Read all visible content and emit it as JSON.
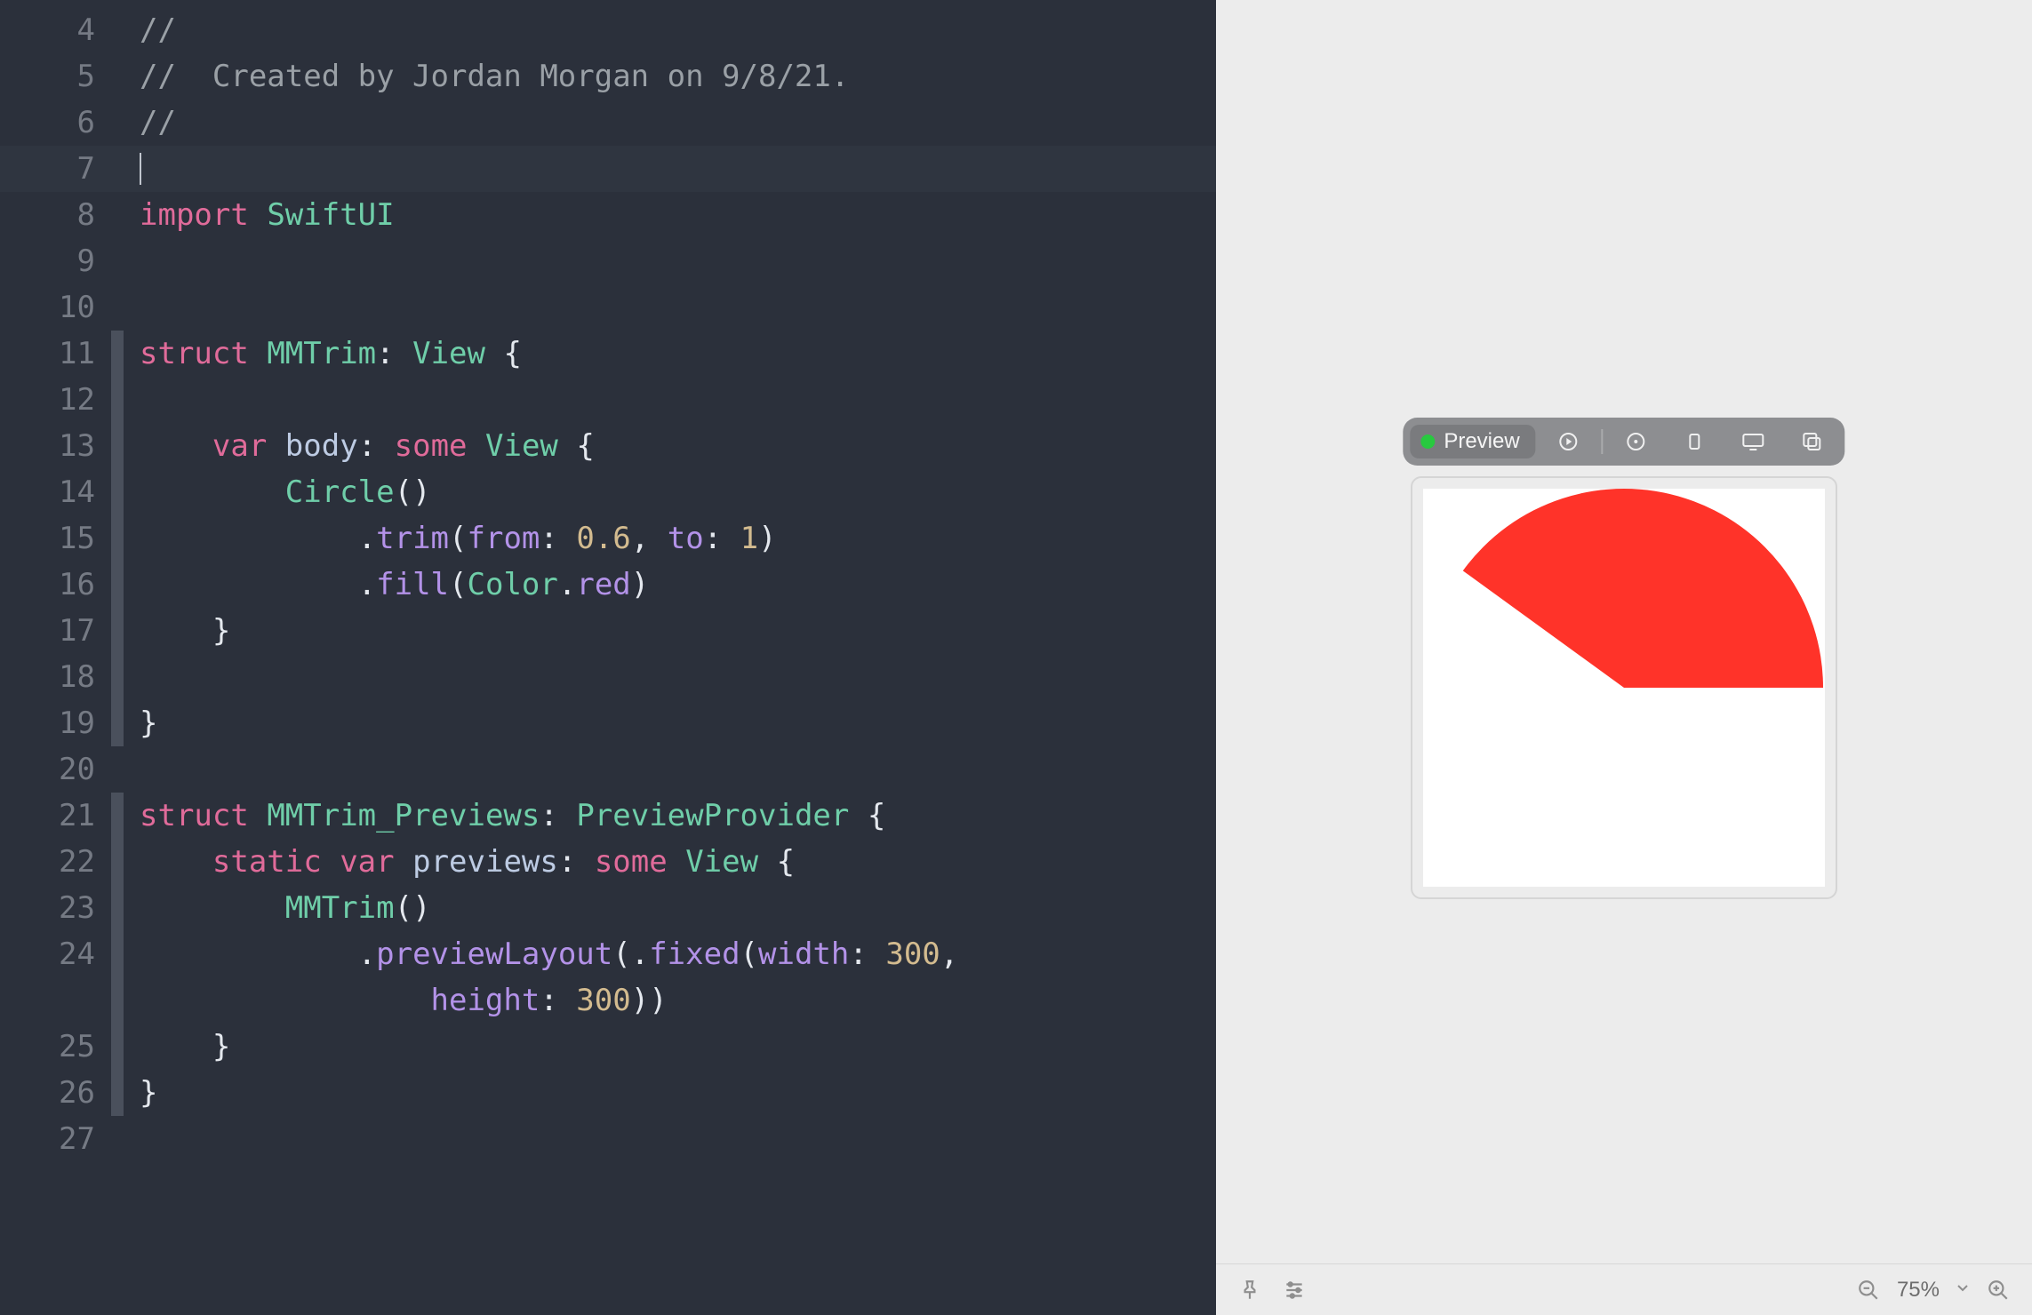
{
  "editor": {
    "lines": [
      {
        "n": 4,
        "fold": false,
        "tokens": [
          [
            "//",
            "c-comment"
          ]
        ]
      },
      {
        "n": 5,
        "fold": false,
        "tokens": [
          [
            "//  Created by Jordan Morgan on 9/8/21.",
            "c-comment"
          ]
        ]
      },
      {
        "n": 6,
        "fold": false,
        "tokens": [
          [
            "//",
            "c-comment"
          ]
        ]
      },
      {
        "n": 7,
        "fold": false,
        "cursor": true,
        "tokens": []
      },
      {
        "n": 8,
        "fold": false,
        "tokens": [
          [
            "import",
            "c-keyword"
          ],
          [
            " ",
            "c-plain"
          ],
          [
            "SwiftUI",
            "c-type"
          ]
        ]
      },
      {
        "n": 9,
        "fold": false,
        "tokens": []
      },
      {
        "n": 10,
        "fold": false,
        "tokens": []
      },
      {
        "n": 11,
        "fold": true,
        "tokens": [
          [
            "struct",
            "c-keyword"
          ],
          [
            " ",
            "c-plain"
          ],
          [
            "MMTrim",
            "c-type"
          ],
          [
            ": ",
            "c-plain"
          ],
          [
            "View",
            "c-type"
          ],
          [
            " {",
            "c-plain"
          ]
        ]
      },
      {
        "n": 12,
        "fold": true,
        "tokens": []
      },
      {
        "n": 13,
        "fold": true,
        "tokens": [
          [
            "    ",
            "c-plain"
          ],
          [
            "var",
            "c-keyword"
          ],
          [
            " ",
            "c-plain"
          ],
          [
            "body",
            "c-ident"
          ],
          [
            ": ",
            "c-plain"
          ],
          [
            "some",
            "c-keyword"
          ],
          [
            " ",
            "c-plain"
          ],
          [
            "View",
            "c-type"
          ],
          [
            " {",
            "c-plain"
          ]
        ]
      },
      {
        "n": 14,
        "fold": true,
        "tokens": [
          [
            "        ",
            "c-plain"
          ],
          [
            "Circle",
            "c-type"
          ],
          [
            "()",
            "c-plain"
          ]
        ]
      },
      {
        "n": 15,
        "fold": true,
        "tokens": [
          [
            "            ",
            "c-plain"
          ],
          [
            ".",
            "c-plain"
          ],
          [
            "trim",
            "c-func"
          ],
          [
            "(",
            "c-plain"
          ],
          [
            "from",
            "c-label"
          ],
          [
            ": ",
            "c-plain"
          ],
          [
            "0.6",
            "c-num"
          ],
          [
            ", ",
            "c-plain"
          ],
          [
            "to",
            "c-label"
          ],
          [
            ": ",
            "c-plain"
          ],
          [
            "1",
            "c-num"
          ],
          [
            ")",
            "c-plain"
          ]
        ]
      },
      {
        "n": 16,
        "fold": true,
        "tokens": [
          [
            "            ",
            "c-plain"
          ],
          [
            ".",
            "c-plain"
          ],
          [
            "fill",
            "c-func"
          ],
          [
            "(",
            "c-plain"
          ],
          [
            "Color",
            "c-type"
          ],
          [
            ".",
            "c-plain"
          ],
          [
            "red",
            "c-func"
          ],
          [
            ")",
            "c-plain"
          ]
        ]
      },
      {
        "n": 17,
        "fold": true,
        "tokens": [
          [
            "    }",
            "c-plain"
          ]
        ]
      },
      {
        "n": 18,
        "fold": true,
        "tokens": []
      },
      {
        "n": 19,
        "fold": true,
        "tokens": [
          [
            "}",
            "c-plain"
          ]
        ]
      },
      {
        "n": 20,
        "fold": false,
        "tokens": []
      },
      {
        "n": 21,
        "fold": true,
        "tokens": [
          [
            "struct",
            "c-keyword"
          ],
          [
            " ",
            "c-plain"
          ],
          [
            "MMTrim_Previews",
            "c-type"
          ],
          [
            ": ",
            "c-plain"
          ],
          [
            "PreviewProvider",
            "c-type"
          ],
          [
            " {",
            "c-plain"
          ]
        ]
      },
      {
        "n": 22,
        "fold": true,
        "tokens": [
          [
            "    ",
            "c-plain"
          ],
          [
            "static",
            "c-keyword"
          ],
          [
            " ",
            "c-plain"
          ],
          [
            "var",
            "c-keyword"
          ],
          [
            " ",
            "c-plain"
          ],
          [
            "previews",
            "c-ident"
          ],
          [
            ": ",
            "c-plain"
          ],
          [
            "some",
            "c-keyword"
          ],
          [
            " ",
            "c-plain"
          ],
          [
            "View",
            "c-type"
          ],
          [
            " {",
            "c-plain"
          ]
        ]
      },
      {
        "n": 23,
        "fold": true,
        "tokens": [
          [
            "        ",
            "c-plain"
          ],
          [
            "MMTrim",
            "c-type"
          ],
          [
            "()",
            "c-plain"
          ]
        ]
      },
      {
        "n": 24,
        "fold": true,
        "tokens": [
          [
            "            ",
            "c-plain"
          ],
          [
            ".",
            "c-plain"
          ],
          [
            "previewLayout",
            "c-func"
          ],
          [
            "(.",
            "c-plain"
          ],
          [
            "fixed",
            "c-func"
          ],
          [
            "(",
            "c-plain"
          ],
          [
            "width",
            "c-label"
          ],
          [
            ": ",
            "c-plain"
          ],
          [
            "300",
            "c-num"
          ],
          [
            ",",
            "c-plain"
          ]
        ]
      },
      {
        "n": null,
        "fold": true,
        "tokens": [
          [
            "                ",
            "c-plain"
          ],
          [
            "height",
            "c-label"
          ],
          [
            ": ",
            "c-plain"
          ],
          [
            "300",
            "c-num"
          ],
          [
            "))",
            "c-plain"
          ]
        ]
      },
      {
        "n": 25,
        "fold": true,
        "tokens": [
          [
            "    }",
            "c-plain"
          ]
        ]
      },
      {
        "n": 26,
        "fold": true,
        "tokens": [
          [
            "}",
            "c-plain"
          ]
        ]
      },
      {
        "n": 27,
        "fold": false,
        "tokens": []
      }
    ]
  },
  "preview": {
    "toolbar_label": "Preview",
    "trim_color": "#ff3329",
    "trim_from": 0.6,
    "trim_to": 1.0
  },
  "bottombar": {
    "zoom_label": "75%"
  }
}
